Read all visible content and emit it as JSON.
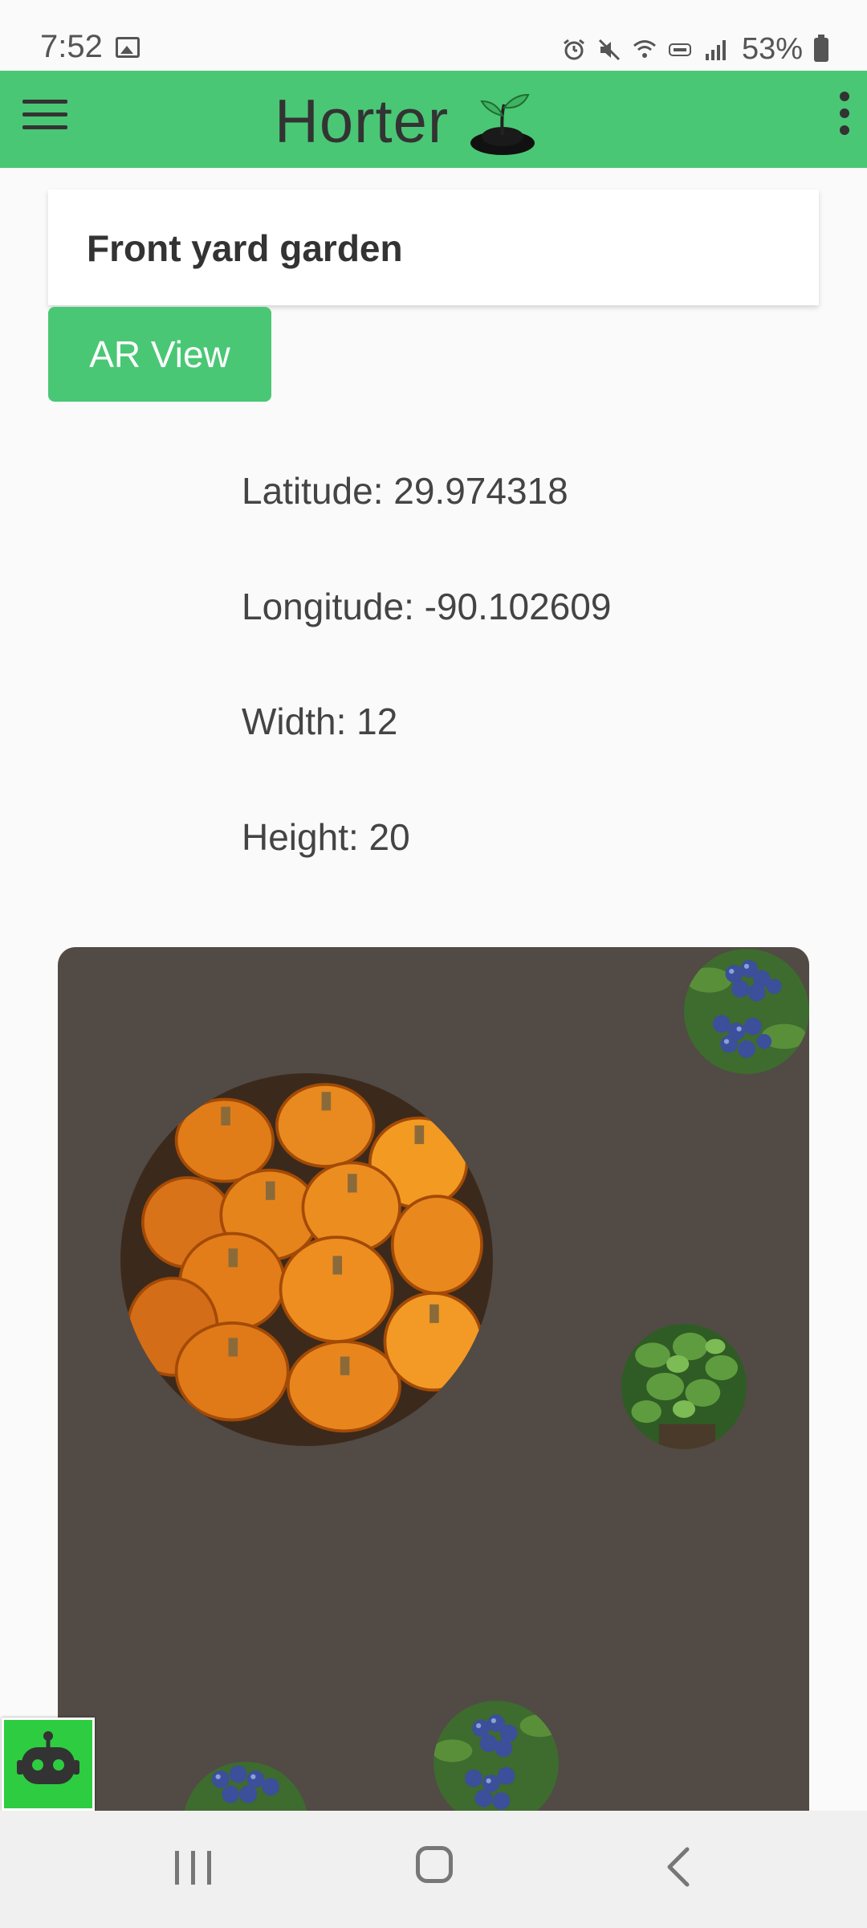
{
  "status_bar": {
    "time": "7:52",
    "battery": "53%",
    "icons": [
      "gallery-icon",
      "alarm-icon",
      "mute-icon",
      "wifi-icon",
      "volte-icon",
      "signal-icon",
      "battery-icon"
    ]
  },
  "app_bar": {
    "title": "Horter",
    "menu_icon": "hamburger-menu-icon",
    "logo_icon": "sprout-icon",
    "overflow_icon": "more-vert-icon",
    "color": "#4ac775"
  },
  "garden": {
    "name": "Front yard garden",
    "ar_button_label": "AR View",
    "latitude_text": "Latitude: 29.974318",
    "longitude_text": "Longitude: -90.102609",
    "width_text": "Width: 12",
    "height_text": "Height: 20",
    "plot_color": "#524a45",
    "plants": [
      {
        "name": "blueberry"
      },
      {
        "name": "pumpkin"
      },
      {
        "name": "fig"
      },
      {
        "name": "blueberry"
      },
      {
        "name": "blueberry"
      }
    ]
  },
  "fab": {
    "icon": "robot-icon",
    "color": "#2ecc40"
  },
  "nav_bar": {
    "icons": [
      "recents-icon",
      "home-icon",
      "back-icon"
    ]
  }
}
